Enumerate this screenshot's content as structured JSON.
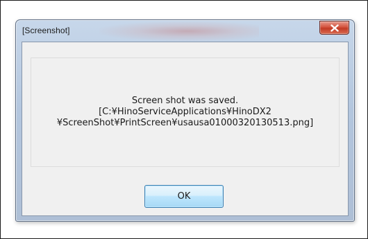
{
  "window": {
    "title": "[Screenshot]",
    "close_icon": "close-x-icon"
  },
  "message": {
    "line1": "Screen shot was saved.",
    "line2": "[C:¥HinoServiceApplications¥HinoDX2",
    "line3": "¥ScreenShot¥PrintScreen¥usausa01000320130513.png]"
  },
  "buttons": {
    "ok_label": "OK"
  },
  "colors": {
    "close_button": "#c94a34",
    "ok_button_border": "#3c7fb1",
    "dialog_background": "#f0f0f0"
  }
}
